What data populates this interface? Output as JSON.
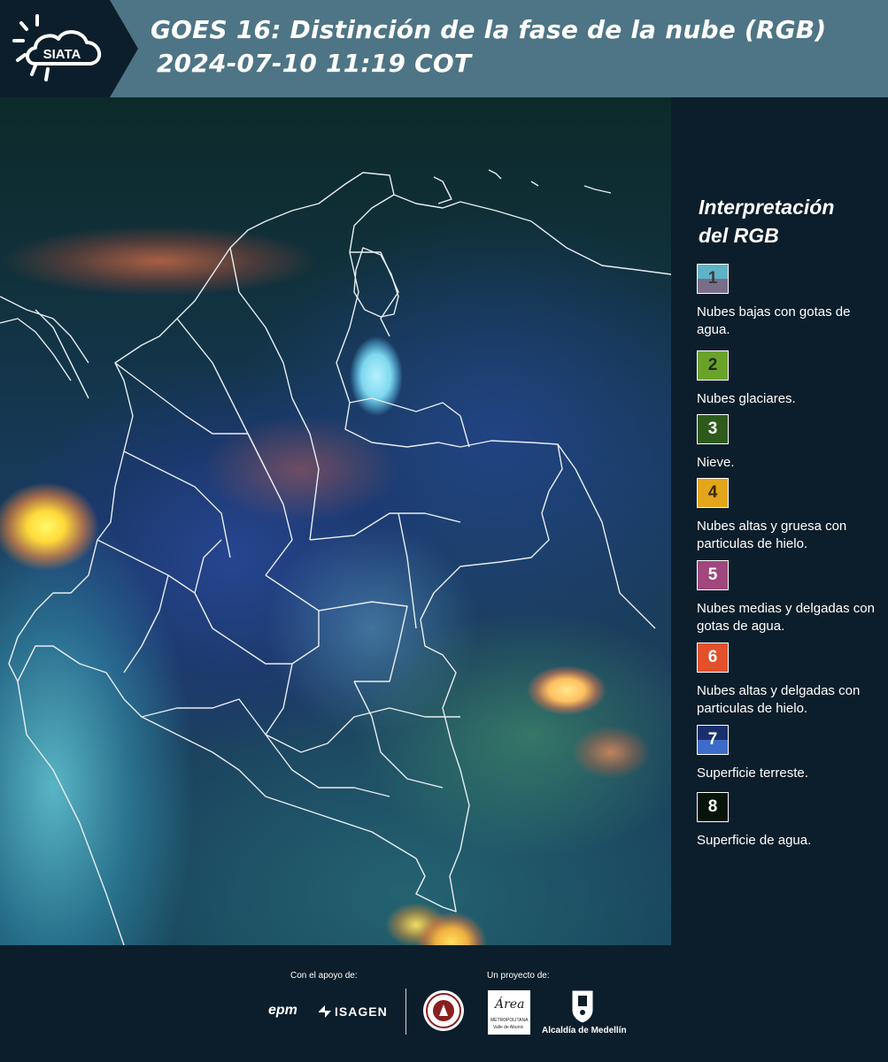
{
  "header": {
    "logo_text": "SIATA",
    "title_line1": "GOES 16: Distinción de la fase de la nube (RGB)",
    "title_line2": "2024-07-10 11:19 COT"
  },
  "legend": {
    "title_line1": "Interpretación",
    "title_line2": "del RGB",
    "items": [
      {
        "number": "1",
        "label": "Nubes bajas con gotas de agua.",
        "color_top": "#5eb3c7",
        "color_bottom": "#7a6d8a"
      },
      {
        "number": "2",
        "label": "Nubes glaciares.",
        "color": "#6aa329"
      },
      {
        "number": "3",
        "label": "Nieve.",
        "color": "#2e5b1c"
      },
      {
        "number": "4",
        "label": "Nubes altas y gruesa con particulas de hielo.",
        "color": "#e3a51a"
      },
      {
        "number": "5",
        "label": "Nubes medias y delgadas con gotas de agua.",
        "color": "#a0477d"
      },
      {
        "number": "6",
        "label": "Nubes altas y delgadas con particulas de hielo.",
        "color": "#e2502c"
      },
      {
        "number": "7",
        "label": "Superficie terreste.",
        "color_top": "#1a2f6b",
        "color_bottom": "#3c6bc8"
      },
      {
        "number": "8",
        "label": "Superficie de agua.",
        "color": "#07140a"
      }
    ]
  },
  "footer": {
    "support_label": "Con el apoyo de:",
    "project_label": "Un proyecto de:",
    "sponsors": [
      "epm",
      "ISAGEN"
    ],
    "partners": [
      "Área Metropolitana Valle de Aburrá",
      "Alcaldía de Medellín"
    ],
    "area_name": "Área",
    "area_sub1": "METROPOLITANA",
    "area_sub2": "Valle de Aburrá",
    "alcaldia": "Alcaldía de Medellín"
  },
  "colors": {
    "header_band": "#4e7585",
    "background": "#0c1e2b"
  }
}
